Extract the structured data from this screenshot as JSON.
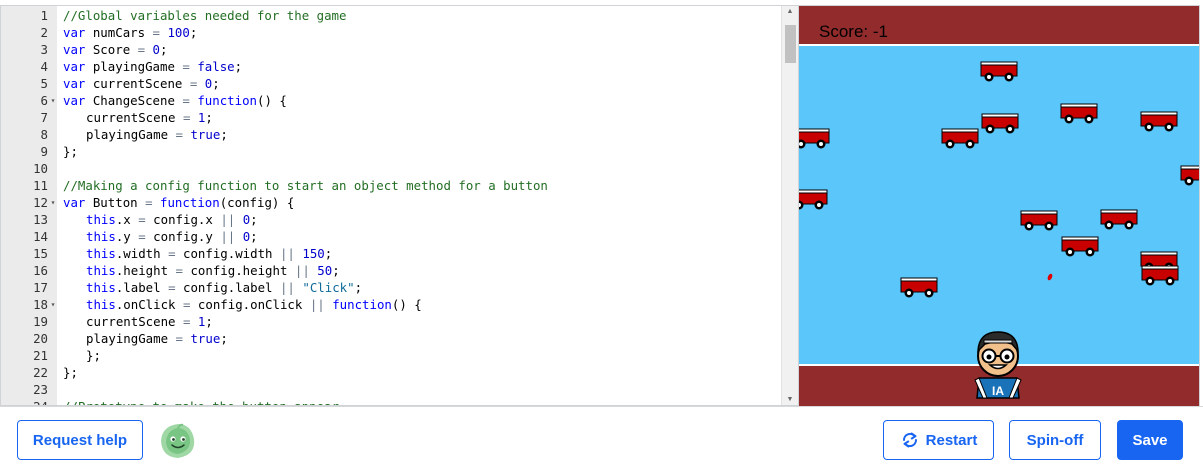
{
  "editor": {
    "lines": [
      {
        "num": "1",
        "fold": false,
        "indent": 0,
        "tokens": [
          [
            "c",
            "//Global variables needed for the game"
          ]
        ]
      },
      {
        "num": "2",
        "fold": false,
        "indent": 0,
        "tokens": [
          [
            "k",
            "var"
          ],
          [
            "p",
            " numCars "
          ],
          [
            "o",
            "="
          ],
          [
            "p",
            " "
          ],
          [
            "n",
            "100"
          ],
          [
            "p",
            ";"
          ]
        ]
      },
      {
        "num": "3",
        "fold": false,
        "indent": 0,
        "tokens": [
          [
            "k",
            "var"
          ],
          [
            "p",
            " Score "
          ],
          [
            "o",
            "="
          ],
          [
            "p",
            " "
          ],
          [
            "n",
            "0"
          ],
          [
            "p",
            ";"
          ]
        ]
      },
      {
        "num": "4",
        "fold": false,
        "indent": 0,
        "tokens": [
          [
            "k",
            "var"
          ],
          [
            "p",
            " playingGame "
          ],
          [
            "o",
            "="
          ],
          [
            "p",
            " "
          ],
          [
            "n",
            "false"
          ],
          [
            "p",
            ";"
          ]
        ]
      },
      {
        "num": "5",
        "fold": false,
        "indent": 0,
        "tokens": [
          [
            "k",
            "var"
          ],
          [
            "p",
            " currentScene "
          ],
          [
            "o",
            "="
          ],
          [
            "p",
            " "
          ],
          [
            "n",
            "0"
          ],
          [
            "p",
            ";"
          ]
        ]
      },
      {
        "num": "6",
        "fold": true,
        "indent": 0,
        "tokens": [
          [
            "k",
            "var"
          ],
          [
            "p",
            " ChangeScene "
          ],
          [
            "o",
            "="
          ],
          [
            "p",
            " "
          ],
          [
            "k",
            "function"
          ],
          [
            "p",
            "() {"
          ]
        ]
      },
      {
        "num": "7",
        "fold": false,
        "indent": 1,
        "tokens": [
          [
            "p",
            "currentScene "
          ],
          [
            "o",
            "="
          ],
          [
            "p",
            " "
          ],
          [
            "n",
            "1"
          ],
          [
            "p",
            ";"
          ]
        ]
      },
      {
        "num": "8",
        "fold": false,
        "indent": 1,
        "tokens": [
          [
            "p",
            "playingGame "
          ],
          [
            "o",
            "="
          ],
          [
            "p",
            " "
          ],
          [
            "n",
            "true"
          ],
          [
            "p",
            ";"
          ]
        ]
      },
      {
        "num": "9",
        "fold": false,
        "indent": 0,
        "tokens": [
          [
            "p",
            "};"
          ]
        ]
      },
      {
        "num": "10",
        "fold": false,
        "indent": 0,
        "tokens": []
      },
      {
        "num": "11",
        "fold": false,
        "indent": 0,
        "tokens": [
          [
            "c",
            "//Making a config function to start an object method for a button"
          ]
        ]
      },
      {
        "num": "12",
        "fold": true,
        "indent": 0,
        "tokens": [
          [
            "k",
            "var"
          ],
          [
            "p",
            " Button "
          ],
          [
            "o",
            "="
          ],
          [
            "p",
            " "
          ],
          [
            "k",
            "function"
          ],
          [
            "p",
            "(config) {"
          ]
        ]
      },
      {
        "num": "13",
        "fold": false,
        "indent": 1,
        "tokens": [
          [
            "k",
            "this"
          ],
          [
            "p",
            ".x "
          ],
          [
            "o",
            "="
          ],
          [
            "p",
            " config.x "
          ],
          [
            "o",
            "||"
          ],
          [
            "p",
            " "
          ],
          [
            "n",
            "0"
          ],
          [
            "p",
            ";"
          ]
        ]
      },
      {
        "num": "14",
        "fold": false,
        "indent": 1,
        "tokens": [
          [
            "k",
            "this"
          ],
          [
            "p",
            ".y "
          ],
          [
            "o",
            "="
          ],
          [
            "p",
            " config.y "
          ],
          [
            "o",
            "||"
          ],
          [
            "p",
            " "
          ],
          [
            "n",
            "0"
          ],
          [
            "p",
            ";"
          ]
        ]
      },
      {
        "num": "15",
        "fold": false,
        "indent": 1,
        "tokens": [
          [
            "k",
            "this"
          ],
          [
            "p",
            ".width "
          ],
          [
            "o",
            "="
          ],
          [
            "p",
            " config.width "
          ],
          [
            "o",
            "||"
          ],
          [
            "p",
            " "
          ],
          [
            "n",
            "150"
          ],
          [
            "p",
            ";"
          ]
        ]
      },
      {
        "num": "16",
        "fold": false,
        "indent": 1,
        "tokens": [
          [
            "k",
            "this"
          ],
          [
            "p",
            ".height "
          ],
          [
            "o",
            "="
          ],
          [
            "p",
            " config.height "
          ],
          [
            "o",
            "||"
          ],
          [
            "p",
            " "
          ],
          [
            "n",
            "50"
          ],
          [
            "p",
            ";"
          ]
        ]
      },
      {
        "num": "17",
        "fold": false,
        "indent": 1,
        "tokens": [
          [
            "k",
            "this"
          ],
          [
            "p",
            ".label "
          ],
          [
            "o",
            "="
          ],
          [
            "p",
            " config.label "
          ],
          [
            "o",
            "||"
          ],
          [
            "p",
            " "
          ],
          [
            "s",
            "\"Click\""
          ],
          [
            "p",
            ";"
          ]
        ]
      },
      {
        "num": "18",
        "fold": true,
        "indent": 1,
        "tokens": [
          [
            "k",
            "this"
          ],
          [
            "p",
            ".onClick "
          ],
          [
            "o",
            "="
          ],
          [
            "p",
            " config.onClick "
          ],
          [
            "o",
            "||"
          ],
          [
            "p",
            " "
          ],
          [
            "k",
            "function"
          ],
          [
            "p",
            "() {"
          ]
        ]
      },
      {
        "num": "19",
        "fold": false,
        "indent": 1,
        "tokens": [
          [
            "p",
            "currentScene "
          ],
          [
            "o",
            "="
          ],
          [
            "p",
            " "
          ],
          [
            "n",
            "1"
          ],
          [
            "p",
            ";"
          ]
        ]
      },
      {
        "num": "20",
        "fold": false,
        "indent": 1,
        "tokens": [
          [
            "p",
            "playingGame "
          ],
          [
            "o",
            "="
          ],
          [
            "p",
            " "
          ],
          [
            "n",
            "true"
          ],
          [
            "p",
            ";"
          ]
        ]
      },
      {
        "num": "21",
        "fold": false,
        "indent": 1,
        "tokens": [
          [
            "p",
            "};"
          ]
        ]
      },
      {
        "num": "22",
        "fold": false,
        "indent": 0,
        "tokens": [
          [
            "p",
            "};"
          ]
        ]
      },
      {
        "num": "23",
        "fold": false,
        "indent": 0,
        "tokens": []
      },
      {
        "num": "24",
        "fold": false,
        "indent": 0,
        "tokens": [
          [
            "c",
            "//Prototype to make the button appear"
          ]
        ]
      }
    ]
  },
  "game": {
    "score_label": "Score: -1",
    "player_badge": "IA",
    "colors": {
      "sky": "#5ac6f9",
      "road": "#912b2c",
      "lane_line": "#ffffff",
      "car_body": "#c90000"
    }
  },
  "toolbar": {
    "help_label": "Request help",
    "restart_label": "Restart",
    "spinoff_label": "Spin-off",
    "save_label": "Save",
    "accent": "#1865f2"
  }
}
